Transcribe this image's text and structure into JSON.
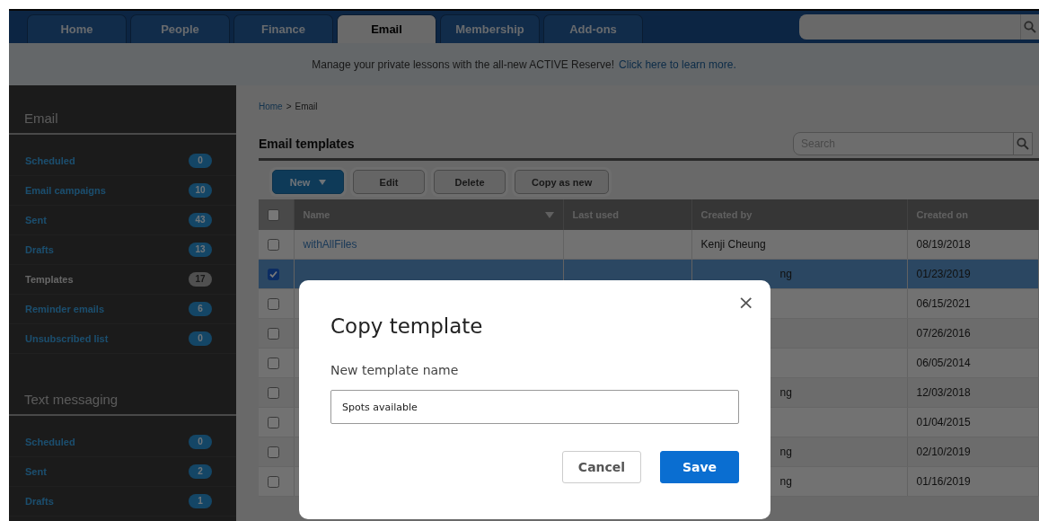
{
  "nav": {
    "tabs": [
      {
        "label": "Home",
        "selected": false
      },
      {
        "label": "People",
        "selected": false
      },
      {
        "label": "Finance",
        "selected": false
      },
      {
        "label": "Email",
        "selected": true
      },
      {
        "label": "Membership",
        "selected": false
      },
      {
        "label": "Add-ons",
        "selected": false
      }
    ]
  },
  "banner": {
    "text": "Manage your private lessons with the all-new ACTIVE Reserve!",
    "link": "Click here to learn more."
  },
  "sidebar": {
    "sections": [
      {
        "title": "Email",
        "items": [
          {
            "label": "Scheduled",
            "count": "0",
            "selected": false
          },
          {
            "label": "Email campaigns",
            "count": "10",
            "selected": false
          },
          {
            "label": "Sent",
            "count": "43",
            "selected": false
          },
          {
            "label": "Drafts",
            "count": "13",
            "selected": false
          },
          {
            "label": "Templates",
            "count": "17",
            "selected": true
          },
          {
            "label": "Reminder emails",
            "count": "6",
            "selected": false
          },
          {
            "label": "Unsubscribed list",
            "count": "0",
            "selected": false
          }
        ]
      },
      {
        "title": "Text messaging",
        "items": [
          {
            "label": "Scheduled",
            "count": "0",
            "selected": false
          },
          {
            "label": "Sent",
            "count": "2",
            "selected": false
          },
          {
            "label": "Drafts",
            "count": "1",
            "selected": false
          }
        ]
      }
    ]
  },
  "breadcrumb": {
    "items": [
      "Home",
      "Email"
    ],
    "separator": ">"
  },
  "title": "Email templates",
  "search": {
    "placeholder": "Search"
  },
  "toolbar": [
    {
      "label": "New",
      "kind": "dropdown"
    },
    {
      "label": "Edit",
      "kind": "plain"
    },
    {
      "label": "Delete",
      "kind": "plain"
    },
    {
      "label": "Copy as new",
      "kind": "plain"
    }
  ],
  "table": {
    "select_all": {
      "checked": false
    },
    "columns": [
      {
        "label": "Name",
        "sorted": true
      },
      {
        "label": "Last used",
        "sorted": false
      },
      {
        "label": "Created by",
        "sorted": false
      },
      {
        "label": "Created on",
        "sorted": false
      }
    ],
    "rows": [
      {
        "checked": false,
        "selected": false,
        "name": "withAllFiles",
        "created_by": "Kenji Cheung",
        "created_by_cut": false,
        "created_on": "08/19/2018"
      },
      {
        "checked": true,
        "selected": true,
        "created_by": "ng",
        "created_by_cut": true,
        "created_on": "01/23/2019"
      },
      {
        "checked": false,
        "selected": false,
        "created_on": "06/15/2021"
      },
      {
        "checked": false,
        "selected": false,
        "created_on": "07/26/2016"
      },
      {
        "checked": false,
        "selected": false,
        "created_on": "06/05/2014"
      },
      {
        "checked": false,
        "selected": false,
        "created_by": "ng",
        "created_by_cut": true,
        "created_on": "12/03/2018"
      },
      {
        "checked": false,
        "selected": false,
        "created_on": "01/04/2015"
      },
      {
        "checked": false,
        "selected": false,
        "created_by": "ng",
        "created_by_cut": true,
        "created_on": "02/10/2019"
      },
      {
        "checked": false,
        "selected": false,
        "created_by": "ng",
        "created_by_cut": true,
        "created_on": "01/16/2019"
      }
    ]
  },
  "dialog": {
    "title": "Copy template",
    "close": "×",
    "field_label": "New template name",
    "value": "Spots available",
    "buttons": [
      {
        "label": "Cancel",
        "kind": "secondary"
      },
      {
        "label": "Save",
        "kind": "primary"
      }
    ]
  }
}
